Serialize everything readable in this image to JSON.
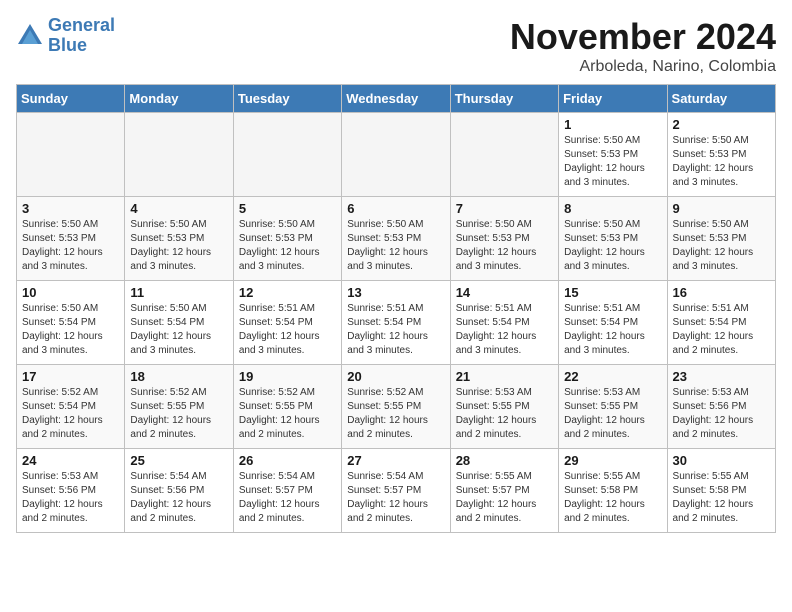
{
  "header": {
    "logo_line1": "General",
    "logo_line2": "Blue",
    "month_title": "November 2024",
    "location": "Arboleda, Narino, Colombia"
  },
  "weekdays": [
    "Sunday",
    "Monday",
    "Tuesday",
    "Wednesday",
    "Thursday",
    "Friday",
    "Saturday"
  ],
  "weeks": [
    [
      {
        "day": "",
        "empty": true
      },
      {
        "day": "",
        "empty": true
      },
      {
        "day": "",
        "empty": true
      },
      {
        "day": "",
        "empty": true
      },
      {
        "day": "",
        "empty": true
      },
      {
        "day": "1",
        "sunrise": "Sunrise: 5:50 AM",
        "sunset": "Sunset: 5:53 PM",
        "daylight": "Daylight: 12 hours and 3 minutes."
      },
      {
        "day": "2",
        "sunrise": "Sunrise: 5:50 AM",
        "sunset": "Sunset: 5:53 PM",
        "daylight": "Daylight: 12 hours and 3 minutes."
      }
    ],
    [
      {
        "day": "3",
        "sunrise": "Sunrise: 5:50 AM",
        "sunset": "Sunset: 5:53 PM",
        "daylight": "Daylight: 12 hours and 3 minutes."
      },
      {
        "day": "4",
        "sunrise": "Sunrise: 5:50 AM",
        "sunset": "Sunset: 5:53 PM",
        "daylight": "Daylight: 12 hours and 3 minutes."
      },
      {
        "day": "5",
        "sunrise": "Sunrise: 5:50 AM",
        "sunset": "Sunset: 5:53 PM",
        "daylight": "Daylight: 12 hours and 3 minutes."
      },
      {
        "day": "6",
        "sunrise": "Sunrise: 5:50 AM",
        "sunset": "Sunset: 5:53 PM",
        "daylight": "Daylight: 12 hours and 3 minutes."
      },
      {
        "day": "7",
        "sunrise": "Sunrise: 5:50 AM",
        "sunset": "Sunset: 5:53 PM",
        "daylight": "Daylight: 12 hours and 3 minutes."
      },
      {
        "day": "8",
        "sunrise": "Sunrise: 5:50 AM",
        "sunset": "Sunset: 5:53 PM",
        "daylight": "Daylight: 12 hours and 3 minutes."
      },
      {
        "day": "9",
        "sunrise": "Sunrise: 5:50 AM",
        "sunset": "Sunset: 5:53 PM",
        "daylight": "Daylight: 12 hours and 3 minutes."
      }
    ],
    [
      {
        "day": "10",
        "sunrise": "Sunrise: 5:50 AM",
        "sunset": "Sunset: 5:54 PM",
        "daylight": "Daylight: 12 hours and 3 minutes."
      },
      {
        "day": "11",
        "sunrise": "Sunrise: 5:50 AM",
        "sunset": "Sunset: 5:54 PM",
        "daylight": "Daylight: 12 hours and 3 minutes."
      },
      {
        "day": "12",
        "sunrise": "Sunrise: 5:51 AM",
        "sunset": "Sunset: 5:54 PM",
        "daylight": "Daylight: 12 hours and 3 minutes."
      },
      {
        "day": "13",
        "sunrise": "Sunrise: 5:51 AM",
        "sunset": "Sunset: 5:54 PM",
        "daylight": "Daylight: 12 hours and 3 minutes."
      },
      {
        "day": "14",
        "sunrise": "Sunrise: 5:51 AM",
        "sunset": "Sunset: 5:54 PM",
        "daylight": "Daylight: 12 hours and 3 minutes."
      },
      {
        "day": "15",
        "sunrise": "Sunrise: 5:51 AM",
        "sunset": "Sunset: 5:54 PM",
        "daylight": "Daylight: 12 hours and 3 minutes."
      },
      {
        "day": "16",
        "sunrise": "Sunrise: 5:51 AM",
        "sunset": "Sunset: 5:54 PM",
        "daylight": "Daylight: 12 hours and 2 minutes."
      }
    ],
    [
      {
        "day": "17",
        "sunrise": "Sunrise: 5:52 AM",
        "sunset": "Sunset: 5:54 PM",
        "daylight": "Daylight: 12 hours and 2 minutes."
      },
      {
        "day": "18",
        "sunrise": "Sunrise: 5:52 AM",
        "sunset": "Sunset: 5:55 PM",
        "daylight": "Daylight: 12 hours and 2 minutes."
      },
      {
        "day": "19",
        "sunrise": "Sunrise: 5:52 AM",
        "sunset": "Sunset: 5:55 PM",
        "daylight": "Daylight: 12 hours and 2 minutes."
      },
      {
        "day": "20",
        "sunrise": "Sunrise: 5:52 AM",
        "sunset": "Sunset: 5:55 PM",
        "daylight": "Daylight: 12 hours and 2 minutes."
      },
      {
        "day": "21",
        "sunrise": "Sunrise: 5:53 AM",
        "sunset": "Sunset: 5:55 PM",
        "daylight": "Daylight: 12 hours and 2 minutes."
      },
      {
        "day": "22",
        "sunrise": "Sunrise: 5:53 AM",
        "sunset": "Sunset: 5:55 PM",
        "daylight": "Daylight: 12 hours and 2 minutes."
      },
      {
        "day": "23",
        "sunrise": "Sunrise: 5:53 AM",
        "sunset": "Sunset: 5:56 PM",
        "daylight": "Daylight: 12 hours and 2 minutes."
      }
    ],
    [
      {
        "day": "24",
        "sunrise": "Sunrise: 5:53 AM",
        "sunset": "Sunset: 5:56 PM",
        "daylight": "Daylight: 12 hours and 2 minutes."
      },
      {
        "day": "25",
        "sunrise": "Sunrise: 5:54 AM",
        "sunset": "Sunset: 5:56 PM",
        "daylight": "Daylight: 12 hours and 2 minutes."
      },
      {
        "day": "26",
        "sunrise": "Sunrise: 5:54 AM",
        "sunset": "Sunset: 5:57 PM",
        "daylight": "Daylight: 12 hours and 2 minutes."
      },
      {
        "day": "27",
        "sunrise": "Sunrise: 5:54 AM",
        "sunset": "Sunset: 5:57 PM",
        "daylight": "Daylight: 12 hours and 2 minutes."
      },
      {
        "day": "28",
        "sunrise": "Sunrise: 5:55 AM",
        "sunset": "Sunset: 5:57 PM",
        "daylight": "Daylight: 12 hours and 2 minutes."
      },
      {
        "day": "29",
        "sunrise": "Sunrise: 5:55 AM",
        "sunset": "Sunset: 5:58 PM",
        "daylight": "Daylight: 12 hours and 2 minutes."
      },
      {
        "day": "30",
        "sunrise": "Sunrise: 5:55 AM",
        "sunset": "Sunset: 5:58 PM",
        "daylight": "Daylight: 12 hours and 2 minutes."
      }
    ]
  ]
}
